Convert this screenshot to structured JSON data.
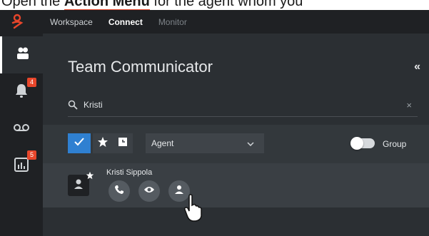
{
  "caption": {
    "prefix": "Open the ",
    "highlight": "Action Menu",
    "suffix": " for the agent whom you"
  },
  "header": {
    "tabs": [
      {
        "label": "Workspace"
      },
      {
        "label": "Connect"
      },
      {
        "label": "Monitor"
      }
    ]
  },
  "sidebar": {
    "items": [
      {
        "icon": "team-communicator-icon"
      },
      {
        "icon": "notifications-bell-icon",
        "badge": "4"
      },
      {
        "icon": "voicemail-icon"
      },
      {
        "icon": "reports-icon",
        "badge": "5"
      }
    ]
  },
  "panel": {
    "title": "Team Communicator",
    "collapse_glyph": "«",
    "search_value": "Kristi",
    "clear_glyph": "×"
  },
  "filters": {
    "agent_select": "Agent",
    "group_label": "Group"
  },
  "result": {
    "name": "Kristi Sippola"
  },
  "colors": {
    "accent": "#2f80d1",
    "badge": "#e8462b",
    "brand": "#e8462b"
  }
}
